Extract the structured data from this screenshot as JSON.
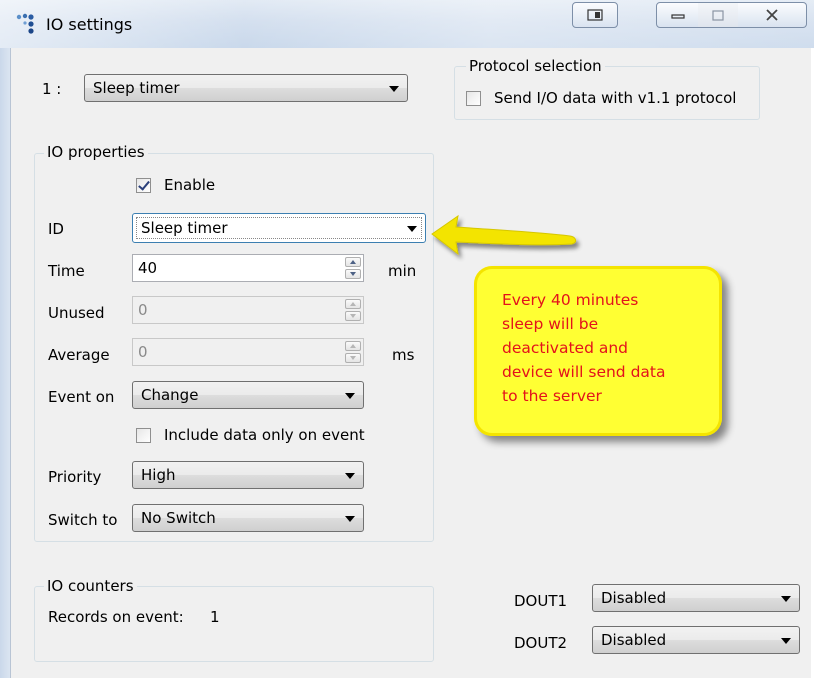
{
  "window": {
    "title": "IO settings",
    "icons": {
      "app": "app-dots-icon",
      "restore": "restore-icon",
      "minimize": "minimize-icon",
      "maximize": "maximize-icon",
      "close": "close-icon"
    }
  },
  "io_select": {
    "index_label": "1  :",
    "value": "Sleep timer"
  },
  "protocol": {
    "legend": "Protocol selection",
    "checkbox_label": "Send I/O data with v1.1 protocol",
    "checked": false
  },
  "io_properties": {
    "legend": "IO properties",
    "enable_label": "Enable",
    "enable_checked": true,
    "id_label": "ID",
    "id_value": "Sleep timer",
    "time_label": "Time",
    "time_value": "40",
    "time_unit": "min",
    "unused_label": "Unused",
    "unused_value": "0",
    "average_label": "Average",
    "average_value": "0",
    "average_unit": "ms",
    "event_on_label": "Event on",
    "event_on_value": "Change",
    "include_label": "Include data only on event",
    "include_checked": false,
    "priority_label": "Priority",
    "priority_value": "High",
    "switch_to_label": "Switch to",
    "switch_to_value": "No Switch"
  },
  "io_counters": {
    "legend": "IO counters",
    "records_label": "Records on event:",
    "records_value": "1"
  },
  "douts": [
    {
      "label": "DOUT1",
      "value": "Disabled"
    },
    {
      "label": "DOUT2",
      "value": "Disabled"
    }
  ],
  "annotation": {
    "lines": [
      "Every 40 minutes",
      "sleep will be",
      "deactivated and",
      "device will send data",
      "to the server"
    ],
    "text_color": "#e3121b",
    "background": "#ffff33",
    "arrow_color": "#f3e400"
  }
}
